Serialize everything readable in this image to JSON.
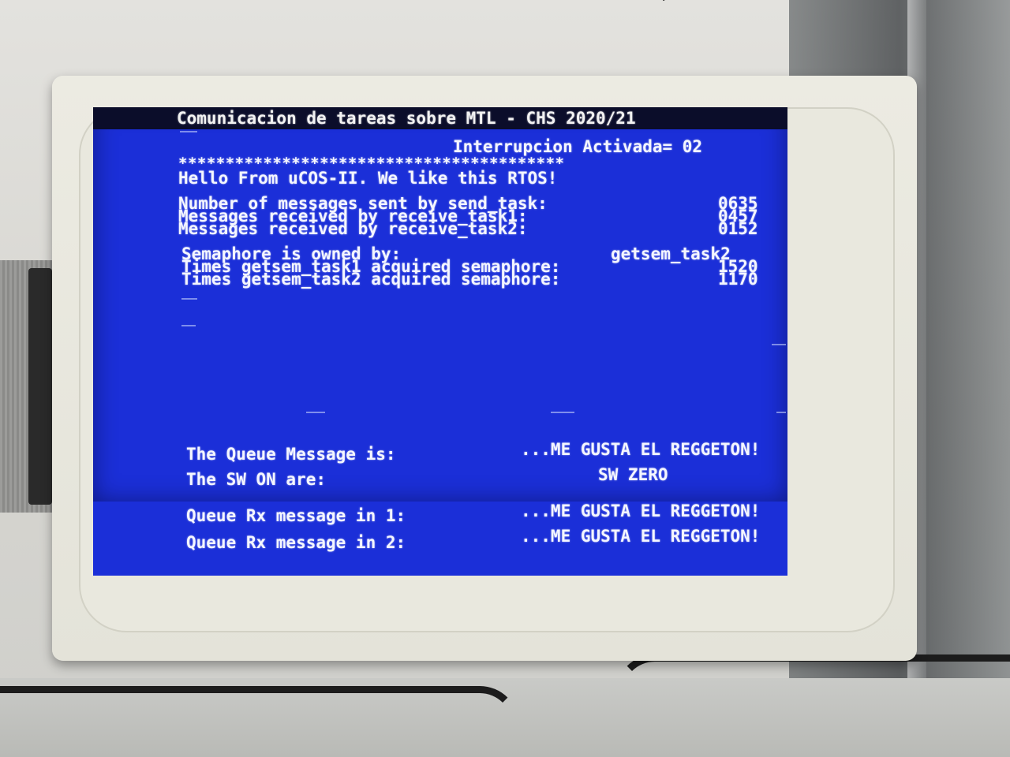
{
  "screen": {
    "title": "Comunicacion de tareas sobre MTL - CHS 2020/21",
    "interrupt_line": "Interrupcion Activada= 02",
    "separator": "*****************************************",
    "hello_line": "Hello From uCOS-II. We like this RTOS!",
    "messages": [
      {
        "label": "Number of messages sent by send_task:",
        "value": "0635"
      },
      {
        "label": "Messages received by receive_task1:",
        "value": "0457"
      },
      {
        "label": "Messages received by receive_task2:",
        "value": "0152"
      }
    ],
    "semaphore": {
      "owner_label": "Semaphore is owned by:",
      "owner_value": "getsem_task2",
      "task1_label": "Times getsem_task1 acquired semaphore:",
      "task1_value": "1520",
      "task2_label": "Times getsem_task2 acquired semaphore:",
      "task2_value": "1170"
    },
    "queue": {
      "message_label": "The Queue Message is:",
      "message_value": "...ME GUSTA EL REGGETON!",
      "sw_label": "The SW ON are:",
      "sw_value": "SW ZERO",
      "rx1_label": "Queue Rx message in 1:",
      "rx1_value": "...ME GUSTA EL REGGETON!",
      "rx2_label": "Queue Rx message in 2:",
      "rx2_value": "...ME GUSTA EL REGGETON!"
    }
  },
  "colors": {
    "lcd_background": "#1b2fd8",
    "text": "#f4f6ff",
    "titlebar": "#0b0d2a",
    "bezel": "#ecebe2"
  }
}
